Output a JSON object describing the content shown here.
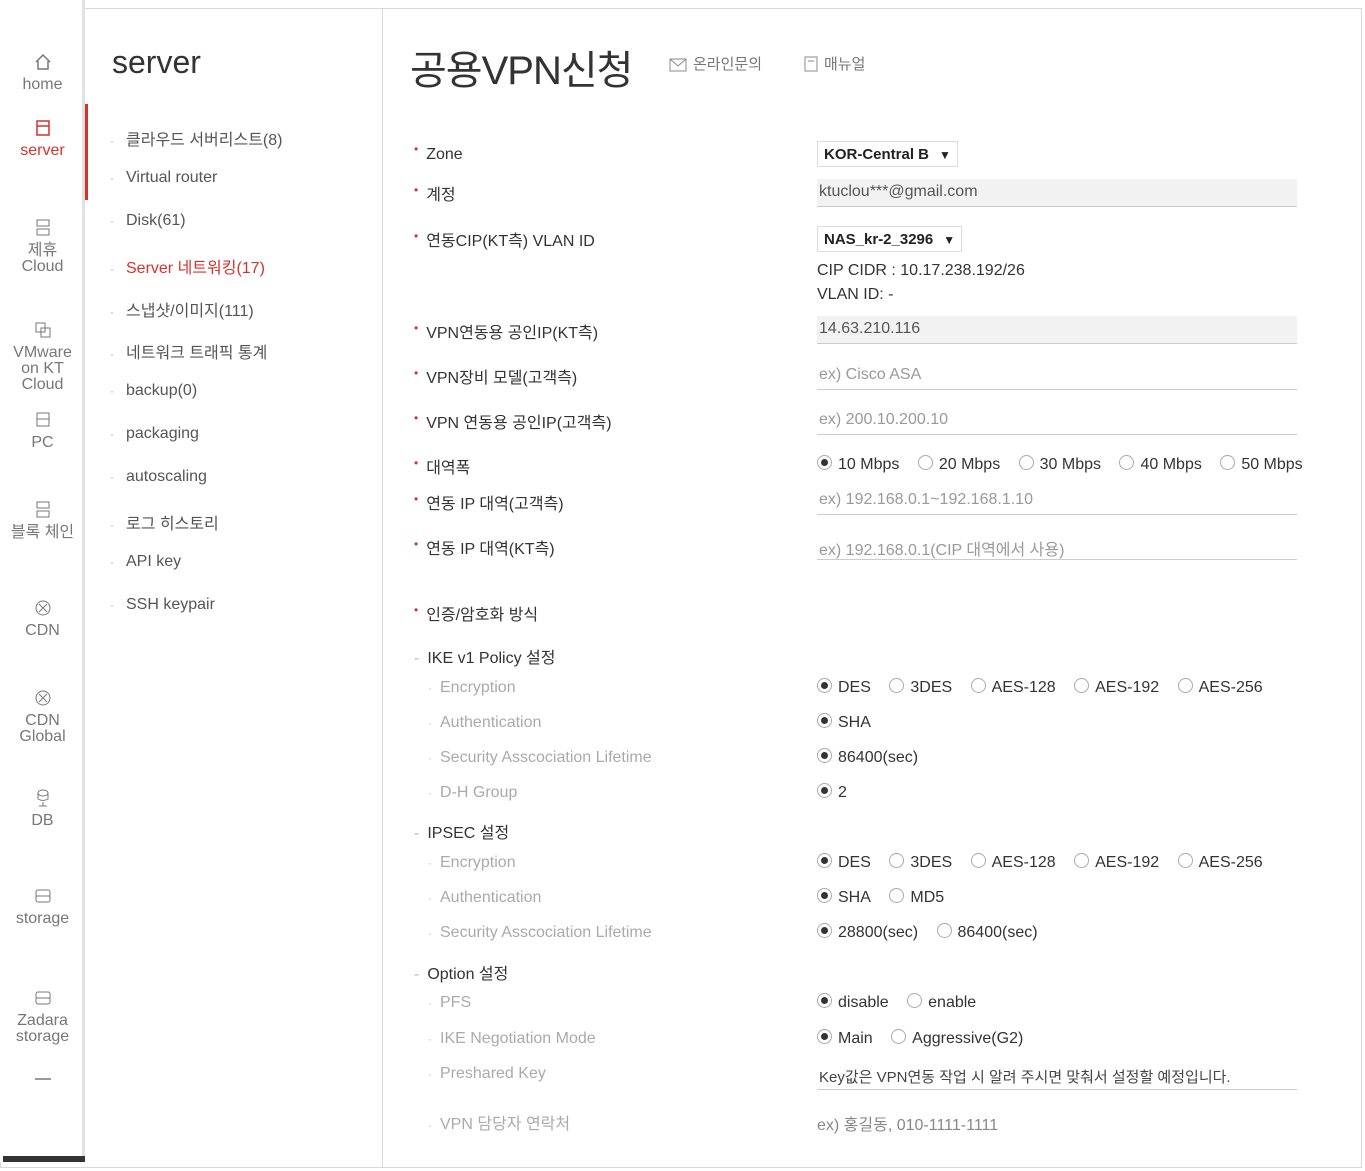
{
  "rail": {
    "items": [
      {
        "label": "home",
        "icon": "home-icon"
      },
      {
        "label": "server",
        "icon": "server-icon"
      },
      {
        "label": "제휴\nCloud",
        "icon": "partner-cloud-icon"
      },
      {
        "label": "VMware\non KT\nCloud",
        "icon": "vmware-icon"
      },
      {
        "label": "PC",
        "icon": "pc-icon"
      },
      {
        "label": "블록 체인",
        "icon": "blockchain-icon"
      },
      {
        "label": "CDN",
        "icon": "cdn-icon"
      },
      {
        "label": "CDN\nGlobal",
        "icon": "cdn-global-icon"
      },
      {
        "label": "DB",
        "icon": "db-icon"
      },
      {
        "label": "storage",
        "icon": "storage-icon"
      },
      {
        "label": "Zadara\nstorage",
        "icon": "zadara-storage-icon"
      }
    ],
    "active_color": "#d6312b"
  },
  "submenu": {
    "title": "server",
    "items": [
      {
        "label": "클라우드 서버리스트(8)"
      },
      {
        "label": "Virtual router"
      },
      {
        "label": "Disk(61)"
      },
      {
        "label": "Server 네트워킹(17)"
      },
      {
        "label": "스냅샷/이미지(111)"
      },
      {
        "label": "네트워크 트래픽 통계"
      },
      {
        "label": "backup(0)"
      },
      {
        "label": "packaging"
      },
      {
        "label": "autoscaling"
      },
      {
        "label": "로그 히스토리"
      },
      {
        "label": "API key"
      },
      {
        "label": "SSH keypair"
      }
    ]
  },
  "main": {
    "title": "공용VPN신청",
    "links": {
      "inquiry": "온라인문의",
      "manual": "매뉴얼"
    },
    "form": {
      "zone": {
        "label": "Zone",
        "value": "KOR-Central B"
      },
      "account": {
        "label": "계정",
        "value": "ktuclou***@gmail.com"
      },
      "vlan": {
        "label": "연동CIP(KT측) VLAN ID",
        "value": "NAS_kr-2_3296",
        "cidr": "CIP CIDR : 10.17.238.192/26",
        "vlan_id": "VLAN ID: -"
      },
      "kt_ip": {
        "label": "VPN연동용 공인IP(KT측)",
        "value": "14.63.210.116"
      },
      "model": {
        "label": "VPN장비 모델(고객측)",
        "placeholder": "ex) Cisco ASA"
      },
      "cust_ip": {
        "label": "VPN 연동용 공인IP(고객측)",
        "placeholder": "ex) 200.10.200.10"
      },
      "bandwidth": {
        "label": "대역폭",
        "options": [
          "10 Mbps",
          "20 Mbps",
          "30 Mbps",
          "40 Mbps",
          "50 Mbps"
        ]
      },
      "cust_range": {
        "label": "연동 IP 대역(고객측)",
        "placeholder": "ex)  192.168.0.1~192.168.1.10"
      },
      "kt_range": {
        "label": "연동 IP 대역(KT측)",
        "placeholder": "ex) 192.168.0.1(CIP 대역에서 사용)"
      },
      "auth_method": {
        "label": "인증/암호화 방식"
      },
      "ike": {
        "title": "IKE v1 Policy 설정",
        "encryption": {
          "label": "Encryption",
          "options": [
            "DES",
            "3DES",
            "AES-128",
            "AES-192",
            "AES-256"
          ]
        },
        "authentication": {
          "label": "Authentication",
          "options": [
            "SHA"
          ]
        },
        "lifetime": {
          "label": "Security Asscociation Lifetime",
          "options": [
            "86400(sec)"
          ]
        },
        "dh": {
          "label": "D-H Group",
          "options": [
            "2"
          ]
        }
      },
      "ipsec": {
        "title": "IPSEC 설정",
        "encryption": {
          "label": "Encryption",
          "options": [
            "DES",
            "3DES",
            "AES-128",
            "AES-192",
            "AES-256"
          ]
        },
        "authentication": {
          "label": "Authentication",
          "options": [
            "SHA",
            "MD5"
          ]
        },
        "lifetime": {
          "label": "Security Asscociation Lifetime",
          "options": [
            "28800(sec)",
            "86400(sec)"
          ]
        }
      },
      "option": {
        "title": "Option 설정",
        "pfs": {
          "label": "PFS",
          "options": [
            "disable",
            "enable"
          ]
        },
        "ike_mode": {
          "label": "IKE Negotiation Mode",
          "options": [
            "Main",
            "Aggressive(G2)"
          ]
        },
        "psk": {
          "label": "Preshared Key",
          "value": "Key값은 VPN연동 작업 시 알려 주시면 맞춰서 설정할 예정입니다."
        }
      },
      "contact": {
        "label": "VPN 담당자 연락처",
        "placeholder": "ex) 홍길동, 010-1111-1111"
      }
    }
  }
}
